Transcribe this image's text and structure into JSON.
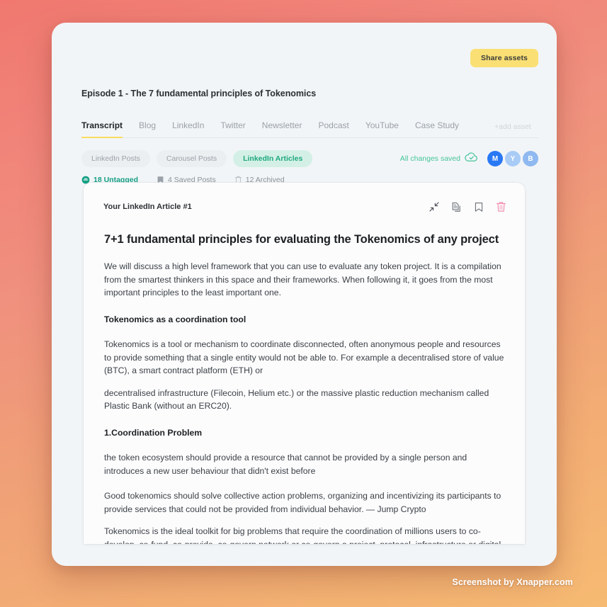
{
  "watermark": "Screenshot by Xnapper.com",
  "colors": {
    "accent_yellow": "#fae074",
    "tab_underline": "#fadc62",
    "chip_active_bg": "#d4f0e6",
    "chip_active_text": "#1fa97f",
    "saved_green": "#45c49a",
    "untagged_green": "#16a085",
    "trash_pink": "#f48fb1",
    "avatar_m": "#2979f5",
    "avatar_y": "#a9ccf7",
    "avatar_b": "#8fb9f0",
    "panel_bg": "#f2f5f7",
    "card_bg": "#fcfcfd"
  },
  "header": {
    "share_button": "Share assets",
    "episode_title": "Episode 1 - The 7 fundamental principles of Tokenomics"
  },
  "tabs": {
    "items": [
      {
        "label": "Transcript",
        "active": true
      },
      {
        "label": "Blog",
        "active": false
      },
      {
        "label": "LinkedIn",
        "active": false
      },
      {
        "label": "Twitter",
        "active": false
      },
      {
        "label": "Newsletter",
        "active": false
      },
      {
        "label": "Podcast",
        "active": false
      },
      {
        "label": "YouTube",
        "active": false
      },
      {
        "label": "Case Study",
        "active": false
      }
    ],
    "add_asset": "+add asset"
  },
  "chips": {
    "items": [
      {
        "label": "LinkedIn Posts",
        "active": false
      },
      {
        "label": "Carousel Posts",
        "active": false
      },
      {
        "label": "LinkedIn Articles",
        "active": true
      }
    ]
  },
  "save_status": {
    "text": "All changes saved",
    "icon": "cloud-check-icon"
  },
  "avatars": [
    {
      "initial": "M",
      "color": "#2979f5"
    },
    {
      "initial": "Y",
      "color": "#a9ccf7"
    },
    {
      "initial": "B",
      "color": "#8fb9f0"
    }
  ],
  "status_row": {
    "items": [
      {
        "label": "18 Untagged",
        "icon": "tag-icon",
        "highlight": true
      },
      {
        "label": "4 Saved Posts",
        "icon": "bookmark-icon",
        "highlight": false
      },
      {
        "label": "12 Archived",
        "icon": "trash-icon",
        "highlight": false
      }
    ]
  },
  "article": {
    "card_label": "Your LinkedIn Article #1",
    "icons": [
      {
        "name": "collapse-icon"
      },
      {
        "name": "duplicate-icon"
      },
      {
        "name": "bookmark-icon"
      },
      {
        "name": "delete-icon"
      }
    ],
    "title": "7+1 fundamental principles for evaluating the Tokenomics of any project",
    "blocks": [
      {
        "type": "paragraph",
        "text": "We will discuss a high level framework that you can use to evaluate any token project. It is a compilation from the smartest thinkers in this space and their frameworks. When following it, it goes from the most important principles to the least important one."
      },
      {
        "type": "heading",
        "text": "Tokenomics as a coordination tool"
      },
      {
        "type": "paragraph",
        "text": "Tokenomics is a tool or mechanism to coordinate disconnected, often anonymous people and resources to provide something that a single entity would not be able to. For example a decentralised store of value (BTC), a smart contract platform (ETH) or"
      },
      {
        "type": "paragraph-tight",
        "text": "decentralised infrastructure (Filecoin, Helium etc.) or the massive plastic reduction mechanism called Plastic Bank (without an ERC20)."
      },
      {
        "type": "heading",
        "text": "1.Coordination Problem"
      },
      {
        "type": "paragraph",
        "text": "the token ecosystem should provide a resource that cannot be provided by a single person and introduces a new user behaviour that didn't exist before"
      },
      {
        "type": "paragraph",
        "text": "Good tokenomics should solve collective action problems, organizing and incentivizing its participants to provide services that could not be provided from individual behavior. — Jump Crypto"
      },
      {
        "type": "paragraph-tight",
        "text": "Tokenomics is the ideal toolkit for big problems that require the coordination of millions users to co-develop, co-fund, co-provide, co-govern network or co-govern a project, protocol, infrastructure or digital public good. The Bitcoin payments"
      }
    ]
  }
}
